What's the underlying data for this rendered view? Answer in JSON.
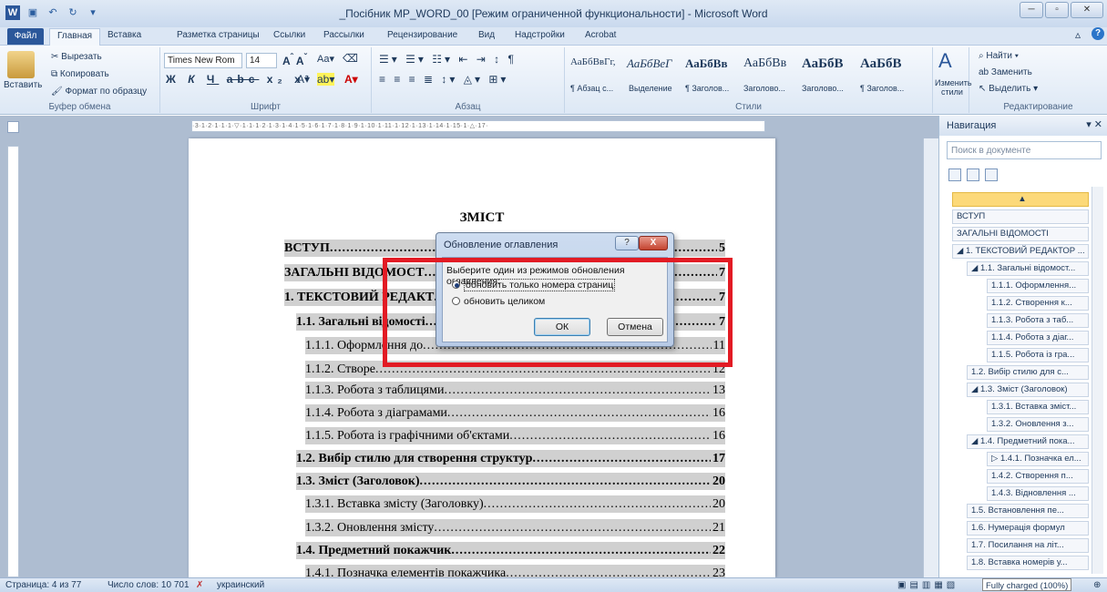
{
  "window": {
    "title": "_Посібник MP_WORD_00 [Режим ограниченной функциональности] - Microsoft Word",
    "app_icon": "W"
  },
  "tabs": [
    "Файл",
    "Главная",
    "Вставка",
    "Разметка страницы",
    "Ссылки",
    "Рассылки",
    "Рецензирование",
    "Вид",
    "Надстройки",
    "Acrobat"
  ],
  "clipboard": {
    "paste": "Вставить",
    "cut": "Вырезать",
    "copy": "Копировать",
    "format_painter": "Формат по образцу",
    "label": "Буфер обмена"
  },
  "font": {
    "name": "Times New Rom",
    "size": "14",
    "label": "Шрифт"
  },
  "paragraph": {
    "label": "Абзац"
  },
  "styles": {
    "items": [
      {
        "sample": "АаБбВвГг,",
        "name": "¶ Абзац с..."
      },
      {
        "sample": "АаБбВеГ",
        "name": "Выделение"
      },
      {
        "sample": "АаБбВв",
        "name": "¶ Заголов..."
      },
      {
        "sample": "АаБбВв",
        "name": "Заголово..."
      },
      {
        "sample": "АаБбВ",
        "name": "Заголово..."
      },
      {
        "sample": "АаБбВ",
        "name": "¶ Заголов..."
      }
    ],
    "change": "Изменить стили",
    "label": "Стили"
  },
  "editing": {
    "find": "Найти",
    "replace": "Заменить",
    "select": "Выделить",
    "label": "Редактирование"
  },
  "document": {
    "heading": "ЗМІСТ",
    "toc": [
      {
        "text": "ВСТУП",
        "page": "5"
      },
      {
        "text": "ЗАГАЛЬНІ ВІДОМОСТ",
        "page": "7"
      },
      {
        "text": "1. ТЕКСТОВИЙ РЕДАКТ",
        "page": "7"
      },
      {
        "text": "1.1. Загальні відомості",
        "page": "7"
      },
      {
        "text": "1.1.1. Оформлення до",
        "page": "11"
      },
      {
        "text": "1.1.2. Створе",
        "page": "12"
      },
      {
        "text": "1.1.3. Робота з таблицями",
        "page": "13"
      },
      {
        "text": "1.1.4. Робота з діаграмами",
        "page": "16"
      },
      {
        "text": "1.1.5. Робота із графічними об'єктами",
        "page": "16"
      },
      {
        "text": "1.2. Вибір стилю для створення структур",
        "page": "17"
      },
      {
        "text": "1.3. Зміст (Заголовок)",
        "page": "20"
      },
      {
        "text": "1.3.1. Вставка змісту (Заголовку)",
        "page": "20"
      },
      {
        "text": "1.3.2. Оновлення змісту",
        "page": "21"
      },
      {
        "text": "1.4. Предметний покажчик",
        "page": "22"
      },
      {
        "text": "1.4.1. Позначка елементів покажчика",
        "page": "23"
      }
    ]
  },
  "dialog": {
    "title": "Обновление оглавления",
    "prompt": "Выберите один из режимов обновления оглавления:",
    "option1": "обновить только номера страниц",
    "option2": "обновить целиком",
    "ok": "ОК",
    "cancel": "Отмена",
    "help": "?",
    "close": "X"
  },
  "navigation": {
    "title": "Навигация",
    "search_placeholder": "Поиск в документе",
    "items": [
      "ВСТУП",
      "ЗАГАЛЬНІ ВІДОМОСТІ",
      "◢ 1. ТЕКСТОВИЙ РЕДАКТОР ...",
      "◢ 1.1. Загальні відомост...",
      "1.1.1. Оформлення...",
      "1.1.2. Створення к...",
      "1.1.3. Робота з таб...",
      "1.1.4. Робота з діаг...",
      "1.1.5. Робота із гра...",
      "1.2. Вибір стилю для с...",
      "◢ 1.3. Зміст (Заголовок)",
      "1.3.1. Вставка зміст...",
      "1.3.2. Оновлення з...",
      "◢ 1.4. Предметний пока...",
      "▷ 1.4.1. Позначка ел...",
      "1.4.2. Створення п...",
      "1.4.3. Відновлення ...",
      "1.5. Встановлення пе...",
      "1.6. Нумерація формул",
      "1.7. Посилання на літ...",
      "1.8. Вставка номерів у..."
    ]
  },
  "status": {
    "page": "Страница: 4 из 77",
    "words": "Число слов: 10 701",
    "language": "украинский",
    "battery": "Fully charged (100%)"
  }
}
